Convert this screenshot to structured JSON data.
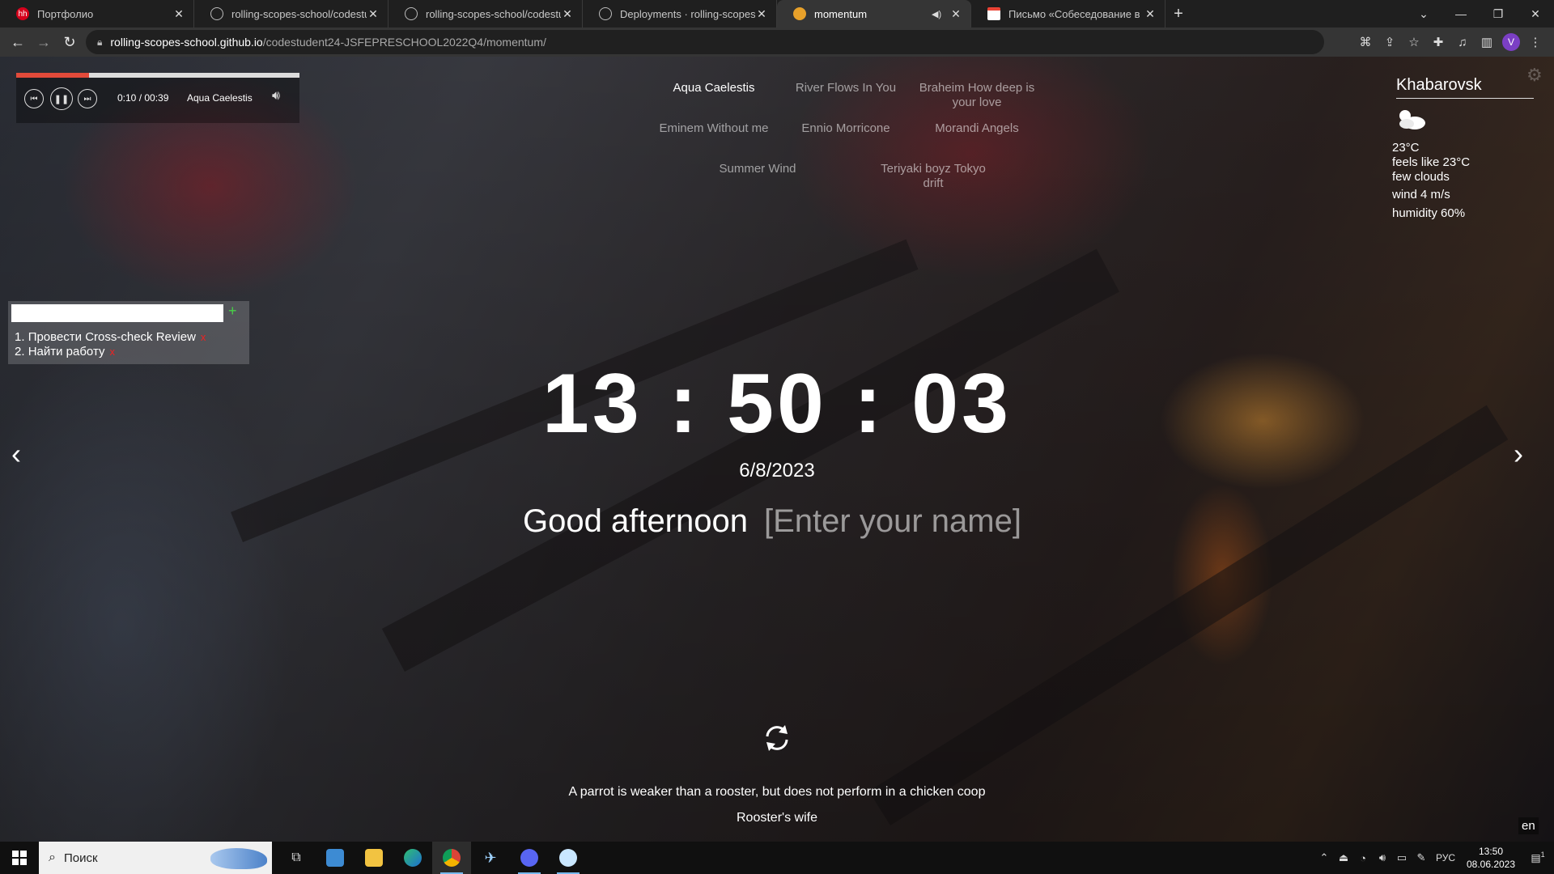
{
  "browser": {
    "tabs": [
      {
        "title": "Портфолио",
        "favicon": "hh",
        "active": false
      },
      {
        "title": "rolling-scopes-school/codestude",
        "favicon": "github-icon",
        "active": false
      },
      {
        "title": "rolling-scopes-school/codestude",
        "favicon": "github-icon",
        "active": false
      },
      {
        "title": "Deployments · rolling-scopes-sch",
        "favicon": "github-icon",
        "active": false
      },
      {
        "title": "momentum",
        "favicon": "momentum-icon",
        "active": true
      },
      {
        "title": "Письмо «Собеседование в RAS»",
        "favicon": "gmail-icon",
        "active": false
      }
    ],
    "url_host": "rolling-scopes-school.github.io",
    "url_path": "/codestudent24-JSFEPRESCHOOL2022Q4/momentum/",
    "profile_initial": "V"
  },
  "player": {
    "progress": 0.256,
    "time": "0:10 / 00:39",
    "track": "Aqua Caelestis"
  },
  "playlist": [
    {
      "title": "Aqua Caelestis",
      "active": true
    },
    {
      "title": "River Flows In You",
      "active": false
    },
    {
      "title": "Braheim How deep is your love",
      "active": false
    },
    {
      "title": "Eminem Without me",
      "active": false
    },
    {
      "title": "Ennio Morricone",
      "active": false
    },
    {
      "title": "Morandi Angels",
      "active": false
    },
    {
      "title": "Summer Wind",
      "active": false
    },
    {
      "title": "Teriyaki boyz Tokyo drift",
      "active": false
    }
  ],
  "weather": {
    "city": "Khabarovsk",
    "icon": "few-clouds-icon",
    "temperature": "23°C",
    "feels_like": "feels like 23°C",
    "description": "few clouds",
    "wind": "wind 4 m/s",
    "humidity": "humidity 60%"
  },
  "todo": {
    "items": [
      {
        "text": "Провести Cross-check Review",
        "delete": "x"
      },
      {
        "text": "Найти работу",
        "delete": "x"
      }
    ],
    "add_label": "+"
  },
  "clock": {
    "time": "13 : 50 : 03",
    "date": "6/8/2023"
  },
  "greeting": {
    "text": "Good afternoon",
    "name_placeholder": "[Enter your name]"
  },
  "quote": {
    "text": "A parrot is weaker than a rooster, but does not perform in a chicken coop",
    "author": "Rooster's wife"
  },
  "language": "en",
  "taskbar": {
    "search_placeholder": "Поиск",
    "lang": "РУС",
    "time": "13:50",
    "date": "08.06.2023",
    "notifications": "1"
  },
  "colors": {
    "progress_fill": "#e24a3a",
    "todo_add": "#47d147",
    "todo_delete": "#ee2222"
  }
}
